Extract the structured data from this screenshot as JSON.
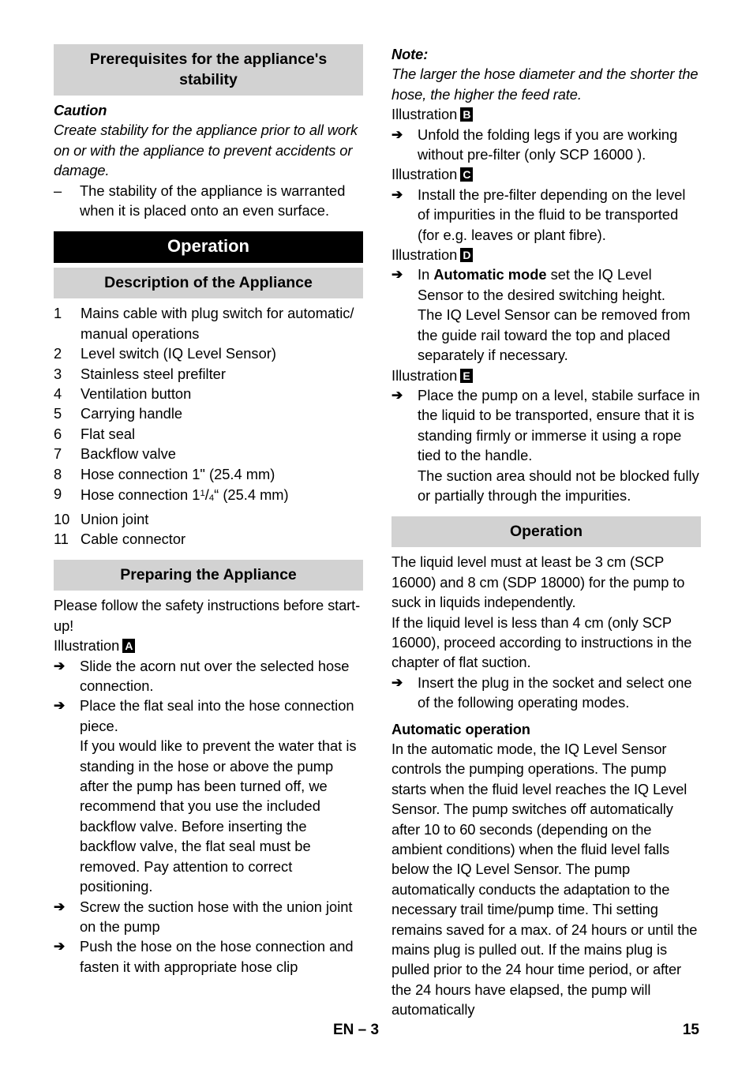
{
  "document": {
    "language_code": "EN",
    "footer_section": "EN – 3",
    "page_number": "15"
  },
  "left_column": {
    "heading_prerequisites": "Prerequisites for the appliance's stability",
    "caution_label": "Caution",
    "caution_text": "Create stability for the appliance prior to all work on or with the appliance to prevent accidents or damage.",
    "dash_items": [
      "The stability of the appliance is warranted when it is placed onto an even surface."
    ],
    "chapter_operation": "Operation",
    "heading_description": "Description of the Appliance",
    "parts": [
      {
        "num": "1",
        "label": "Mains cable with plug switch for automatic/ manual operations"
      },
      {
        "num": "2",
        "label": "Level switch (IQ Level Sensor)"
      },
      {
        "num": "3",
        "label": "Stainless steel prefilter"
      },
      {
        "num": "4",
        "label": "Ventilation button"
      },
      {
        "num": "5",
        "label": "Carrying handle"
      },
      {
        "num": "6",
        "label": "Flat seal"
      },
      {
        "num": "7",
        "label": "Backflow valve"
      },
      {
        "num": "8",
        "label": "Hose connection 1\" (25.4 mm)"
      },
      {
        "num": "9",
        "label_prefix": "Hose connection 1",
        "fraction_num": "1",
        "fraction_den": "4",
        "label_suffix": "“ (25.4 mm)"
      },
      {
        "num": "10",
        "label": "Union joint"
      },
      {
        "num": "11",
        "label": "Cable connector"
      }
    ],
    "heading_preparing": "Preparing the Appliance",
    "preparing_intro": "Please follow the safety instructions before start-up!",
    "illustration_a_label": "Illustration",
    "illustration_a_letter": "A",
    "steps_a": [
      {
        "text": "Slide the acorn nut over the selected hose connection."
      },
      {
        "text": "Place the flat seal into the hose connection piece.",
        "continuation": "If you would like to prevent the water that is standing in the hose or above the pump after the pump has been turned off, we recommend that you use the included backflow valve. Before inserting the backflow valve, the flat seal must be removed. Pay attention to correct positioning."
      },
      {
        "text": "Screw the suction hose with the union joint on the pump"
      },
      {
        "text": "Push the hose on the hose connection and fasten it with appropriate hose clip"
      }
    ]
  },
  "right_column": {
    "note_label": "Note:",
    "note_text": "The larger the hose diameter and the shorter the hose, the higher the feed rate.",
    "illustration_b_label": "Illustration",
    "illustration_b_letter": "B",
    "step_b": "Unfold the folding legs if you  are working without pre-filter (only SCP 16000 ).",
    "illustration_c_label": "Illustration",
    "illustration_c_letter": "C",
    "step_c": "Install the pre-filter depending on the level of impurities in the fluid to be transported (for e.g. leaves or plant fibre).",
    "illustration_d_label": "Illustration",
    "illustration_d_letter": "D",
    "step_d_pre": "In ",
    "step_d_bold": "Automatic mode",
    "step_d_post": " set the IQ Level Sensor to the desired switching height.",
    "step_d_cont": "The IQ Level Sensor can be removed from the guide rail toward the top and placed separately if necessary.",
    "illustration_e_label": "Illustration",
    "illustration_e_letter": "E",
    "step_e": "Place the pump on a level, stabile surface in the liquid to be transported, ensure that it is standing firmly or immerse it using a rope tied to the handle.",
    "step_e_cont": "The suction area should not be blocked fully or partially through the impurities.",
    "heading_operation": "Operation",
    "operation_para_1": "The liquid level must at least be 3 cm (SCP 16000) and 8 cm (SDP 18000) for the pump to suck in liquids independently.",
    "operation_para_2": "If the liquid level is less than 4 cm (only SCP 16000), proceed according to instructions in the chapter of flat suction.",
    "operation_step": "Insert the plug in the socket and select one of the following operating modes.",
    "heading_automatic": "Automatic operation",
    "automatic_text": "In the automatic mode, the IQ Level Sensor controls the pumping operations. The pump starts when the fluid level reaches the IQ Level Sensor. The pump switches off automatically after 10 to 60 seconds (depending on the ambient conditions) when the fluid level falls below the IQ Level Sensor. The pump automatically conducts the adaptation to the necessary trail time/pump time. Thi setting remains saved for a max. of 24 hours or until the mains plug is pulled out. If the mains plug is pulled prior to the 24 hour time period, or after the 24 hours have elapsed, the pump will automatically"
  },
  "colors": {
    "section_bar_gray": "#d2d2d2",
    "chapter_bar_black": "#000000",
    "text": "#000000",
    "page_background": "#ffffff"
  },
  "icons": {
    "arrow": "➔",
    "dash": "–"
  }
}
